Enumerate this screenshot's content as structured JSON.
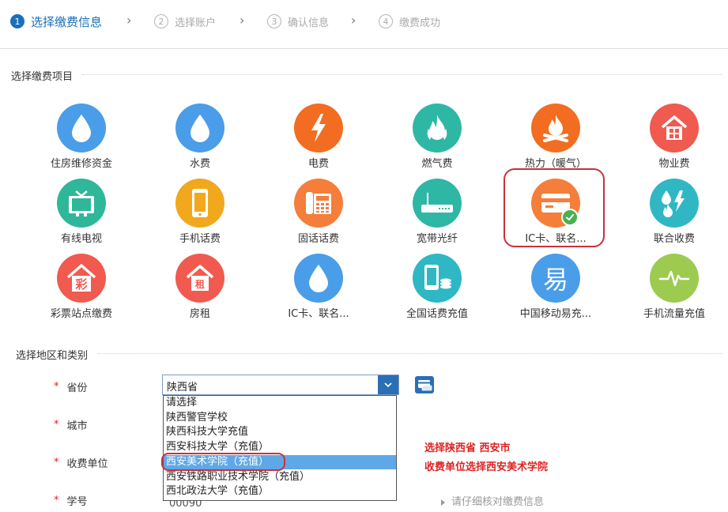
{
  "steps": [
    {
      "num": "1",
      "label": "选择缴费信息",
      "active": true
    },
    {
      "num": "2",
      "label": "选择账户",
      "active": false
    },
    {
      "num": "3",
      "label": "确认信息",
      "active": false
    },
    {
      "num": "4",
      "label": "缴费成功",
      "active": false
    }
  ],
  "section_items_title": "选择缴费项目",
  "items": [
    {
      "label": "住房维修资金",
      "color": "#4a9de8",
      "icon": "water-drop-icon"
    },
    {
      "label": "水费",
      "color": "#4a9de8",
      "icon": "water-drop-icon"
    },
    {
      "label": "电费",
      "color": "#f26d21",
      "icon": "lightning-icon"
    },
    {
      "label": "燃气费",
      "color": "#2fb7a5",
      "icon": "flame-icon"
    },
    {
      "label": "热力（暖气）",
      "color": "#f26d21",
      "icon": "bonfire-icon"
    },
    {
      "label": "物业费",
      "color": "#f05a4f",
      "icon": "house-icon"
    },
    {
      "label": "有线电视",
      "color": "#2fb79a",
      "icon": "tv-icon"
    },
    {
      "label": "手机话费",
      "color": "#f2a81d",
      "icon": "mobile-phone-icon"
    },
    {
      "label": "固话话费",
      "color": "#f47e3a",
      "icon": "landline-phone-icon"
    },
    {
      "label": "宽带光纤",
      "color": "#2fb7a5",
      "icon": "router-icon"
    },
    {
      "label": "IC卡、联名...",
      "color": "#f47e3a",
      "icon": "card-icon"
    },
    {
      "label": "联合收费",
      "color": "#2fb7c4",
      "icon": "combined-fee-icon"
    },
    {
      "label": "彩票站点缴费",
      "color": "#f05a4f",
      "icon": "lottery-house-icon"
    },
    {
      "label": "房租",
      "color": "#f05a4f",
      "icon": "rent-house-icon"
    },
    {
      "label": "IC卡、联名...",
      "color": "#4a9de8",
      "icon": "water-drop-icon"
    },
    {
      "label": "全国话费充值",
      "color": "#2fb7c4",
      "icon": "phone-coins-icon"
    },
    {
      "label": "中国移动易充...",
      "color": "#4a9de8",
      "icon": "yi-icon",
      "glyph": "易"
    },
    {
      "label": "手机流量充值",
      "color": "#9ccb4f",
      "icon": "signal-wave-icon"
    }
  ],
  "section_region_title": "选择地区和类别",
  "form": {
    "required_mark": "*",
    "province_label": "省份",
    "city_label": "城市",
    "unit_label": "收费单位",
    "student_id_label": "学号",
    "province_value": "陕西省",
    "student_id_partial": "00090"
  },
  "dropdown_options": [
    "请选择",
    "陕西警官学校",
    "陕西科技大学充值",
    "西安科技大学（充值）",
    "西安美术学院（充值）",
    "西安铁路职业技术学院（充值）",
    "西北政法大学（充值）"
  ],
  "dropdown_selected_index": 4,
  "annotation": {
    "line1": "选择陕西省 西安市",
    "line2": "收费单位选择西安美术学院"
  },
  "hint": "请仔细核对缴费信息",
  "colors": {
    "primary": "#1a6fba",
    "highlight_red": "#c8323c",
    "selected_option": "#5fa8e8"
  }
}
